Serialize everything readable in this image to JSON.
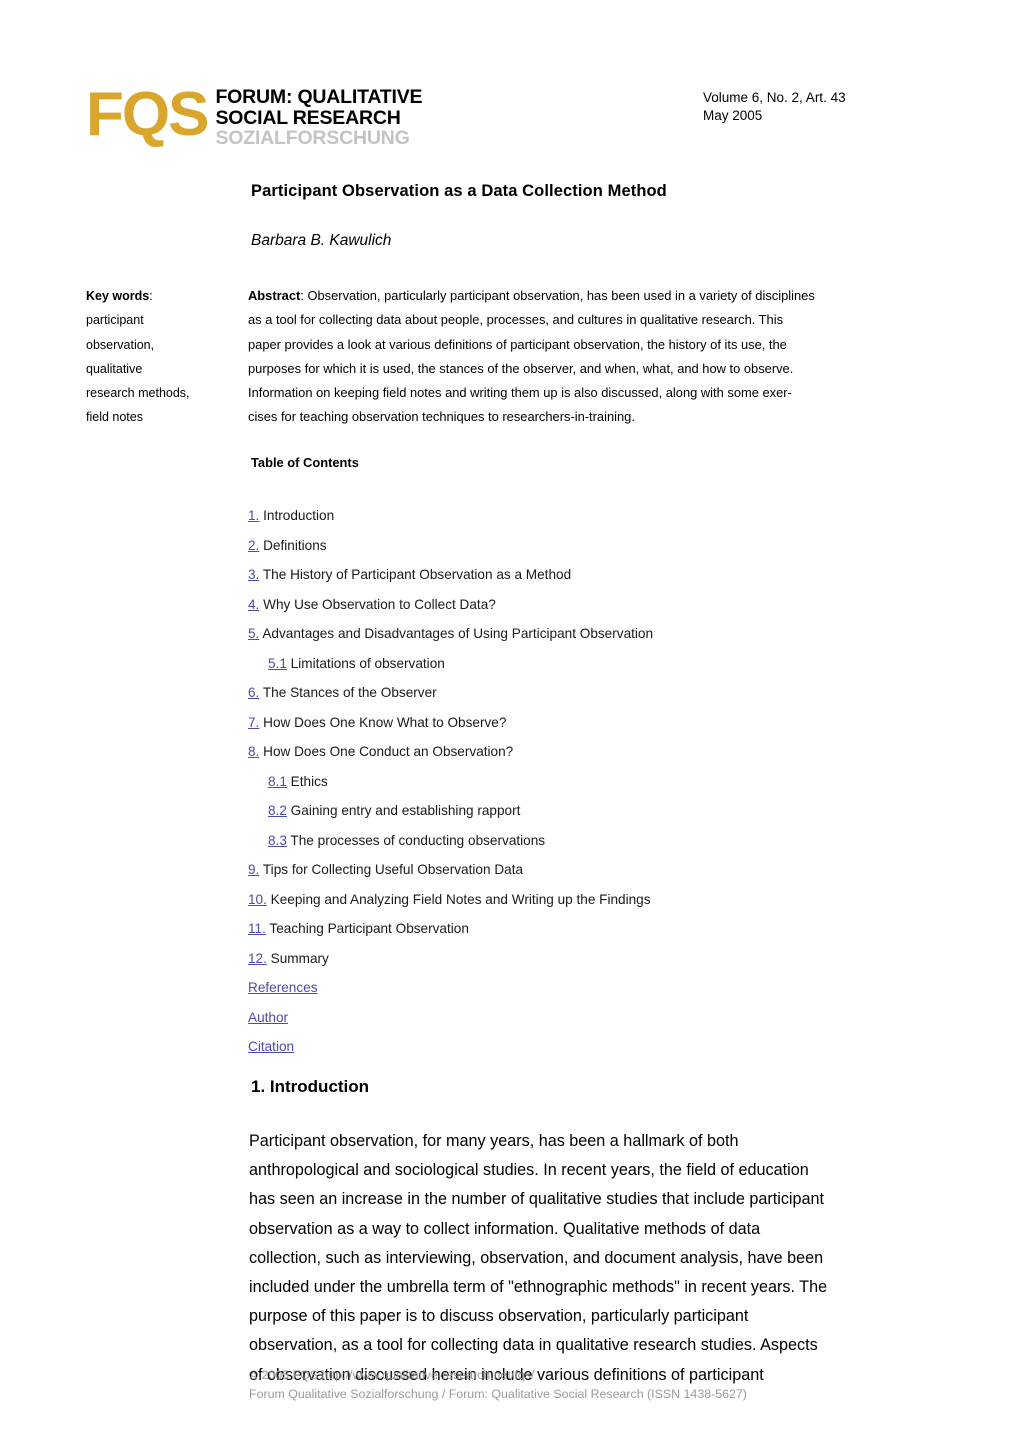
{
  "header": {
    "logo_mark": "FQS",
    "logo_line1": "FORUM: QUALITATIVE",
    "logo_line2": "SOCIAL RESEARCH",
    "logo_line3": "SOZIALFORSCHUNG",
    "logo_color": "#D9A52B",
    "logo_line3_color": "#C3C3C3",
    "issue_line1": "Volume 6, No. 2, Art. 43",
    "issue_line2": "May 2005"
  },
  "article": {
    "title": "Participant Observation as a Data Collection Method",
    "author": "Barbara B. Kawulich"
  },
  "keywords": {
    "label": "Key words",
    "colon": ":",
    "lines": [
      "participant",
      "observation,",
      "qualitative",
      "research methods,",
      "field notes"
    ]
  },
  "abstract": {
    "label": "Abstract",
    "lines": [
      ": Observation, particularly participant observation, has been used in a variety of disciplines",
      "as a tool for collecting data about people, processes, and cultures in qualitative research. This",
      "paper provides a look at various definitions of participant observation, the history of its use, the",
      "purposes for which it is used, the stances of the observer, and when, what, and how to observe.",
      "Information on keeping field notes and writing them up is also discussed, along with some exer-",
      "cises for teaching observation techniques to researchers-in-training."
    ]
  },
  "toc": {
    "heading": "Table of Contents",
    "link_color": "#4C4CA8",
    "items": [
      {
        "num": "1.",
        "label": " Introduction",
        "sub": false
      },
      {
        "num": "2.",
        "label": " Definitions",
        "sub": false
      },
      {
        "num": "3.",
        "label": " The History of Participant Observation as a Method",
        "sub": false
      },
      {
        "num": "4.",
        "label": " Why Use Observation to Collect Data?",
        "sub": false
      },
      {
        "num": "5.",
        "label": " Advantages and Disadvantages of Using Participant Observation",
        "sub": false
      },
      {
        "num": "5.1",
        "label": " Limitations of observation",
        "sub": true
      },
      {
        "num": "6.",
        "label": " The Stances of the Observer",
        "sub": false
      },
      {
        "num": "7.",
        "label": " How Does One Know What to Observe?",
        "sub": false
      },
      {
        "num": "8.",
        "label": " How Does One Conduct an Observation?",
        "sub": false
      },
      {
        "num": "8.1",
        "label": " Ethics",
        "sub": true
      },
      {
        "num": "8.2",
        "label": " Gaining entry and establishing rapport",
        "sub": true
      },
      {
        "num": "8.3",
        "label": " The processes of conducting observations",
        "sub": true
      },
      {
        "num": "9.",
        "label": " Tips for Collecting Useful Observation Data",
        "sub": false
      },
      {
        "num": "10.",
        "label": " Keeping and Analyzing Field Notes and Writing up the Findings",
        "sub": false
      },
      {
        "num": "11.",
        "label": " Teaching Participant Observation",
        "sub": false
      },
      {
        "num": "12.",
        "label": " Summary",
        "sub": false
      },
      {
        "num": "References",
        "label": "",
        "sub": false,
        "whole_link": true
      },
      {
        "num": "Author",
        "label": "",
        "sub": false,
        "whole_link": true
      },
      {
        "num": "Citation",
        "label": "",
        "sub": false,
        "whole_link": true
      }
    ]
  },
  "section1": {
    "heading": "1. Introduction",
    "lines": [
      "Participant observation, for many years, has been a hallmark of both",
      "anthropological and sociological studies. In recent years, the field of education",
      "has seen an increase in the number of qualitative studies that include participant",
      "observation as a way to collect information. Qualitative methods of data",
      "collection, such as interviewing, observation, and document analysis, have been",
      "included under the umbrella term of \"ethnographic methods\" in recent years. The",
      "purpose of this paper is to discuss observation, particularly participant",
      "observation, as a tool for collecting data in qualitative research studies. Aspects",
      "of observation discussed herein include various definitions of participant"
    ]
  },
  "footer": {
    "line1": "© 2005 FQS http://www.qualitative-research.net/fqs/",
    "line2": "Forum Qualitative Sozialforschung / Forum: Qualitative Social Research (ISSN 1438-5627)"
  }
}
